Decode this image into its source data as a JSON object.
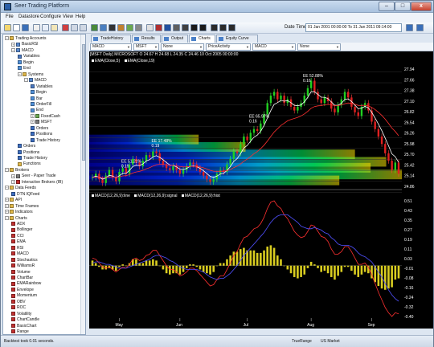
{
  "window": {
    "title": "Seer Trading Platform",
    "min_glyph": "–",
    "max_glyph": "□",
    "close_glyph": "x"
  },
  "menu": [
    "File",
    "Datastore",
    "Configure",
    "View",
    "Help"
  ],
  "toolbar": {
    "date_time_label": "Date Time",
    "date_range": "01 Jan 2001 00:00:00 To 31 Jan 2011 09:14:00"
  },
  "tree": [
    {
      "label": "Trading Accounts",
      "level": 0,
      "exp": "−",
      "color": "#e0b84a"
    },
    {
      "label": "BasicRSI",
      "level": 1,
      "exp": "+",
      "color": "#5a8ad0"
    },
    {
      "label": "MACD",
      "level": 1,
      "exp": "−",
      "color": "#5a8ad0"
    },
    {
      "label": "Variables",
      "level": 2,
      "exp": "",
      "color": "#4a78c0"
    },
    {
      "label": "Begin",
      "level": 2,
      "exp": "",
      "color": "#5090d8"
    },
    {
      "label": "End",
      "level": 2,
      "exp": "",
      "color": "#5090d8"
    },
    {
      "label": "Systems",
      "level": 2,
      "exp": "−",
      "color": "#e0b84a"
    },
    {
      "label": "MACD",
      "level": 3,
      "exp": "−",
      "color": "#5a8ad0"
    },
    {
      "label": "Variables",
      "level": 4,
      "exp": "",
      "color": "#4a78c0"
    },
    {
      "label": "Begin",
      "level": 4,
      "exp": "",
      "color": "#5090d8"
    },
    {
      "label": "Bar",
      "level": 4,
      "exp": "",
      "color": "#5090d8"
    },
    {
      "label": "OrderFill",
      "level": 4,
      "exp": "",
      "color": "#5090d8"
    },
    {
      "label": "End",
      "level": 4,
      "exp": "",
      "color": "#5090d8"
    },
    {
      "label": "FixedCash",
      "level": 4,
      "exp": "+",
      "color": "#6aa84f"
    },
    {
      "label": "MSFT",
      "level": 4,
      "exp": "+",
      "color": "#7a7a7a"
    },
    {
      "label": "Orders",
      "level": 4,
      "exp": "",
      "color": "#3c6ec0"
    },
    {
      "label": "Positions",
      "level": 4,
      "exp": "",
      "color": "#3c6ec0"
    },
    {
      "label": "Trade History",
      "level": 4,
      "exp": "",
      "color": "#3c6ec0"
    },
    {
      "label": "Orders",
      "level": 2,
      "exp": "",
      "color": "#3c6ec0"
    },
    {
      "label": "Positions",
      "level": 2,
      "exp": "",
      "color": "#3c6ec0"
    },
    {
      "label": "Trade History",
      "level": 2,
      "exp": "",
      "color": "#3c6ec0"
    },
    {
      "label": "Functions",
      "level": 2,
      "exp": "",
      "color": "#e0b84a"
    },
    {
      "label": "Brokers",
      "level": 0,
      "exp": "−",
      "color": "#e0b84a"
    },
    {
      "label": "Seer - Paper Trade",
      "level": 1,
      "exp": "+",
      "color": "#7a7a7a"
    },
    {
      "label": "Interactive Brokers (IB)",
      "level": 1,
      "exp": "+",
      "color": "#c03030"
    },
    {
      "label": "Data Feeds",
      "level": 0,
      "exp": "−",
      "color": "#e0b84a"
    },
    {
      "label": "DTN IQFeed",
      "level": 1,
      "exp": "",
      "color": "#3c6ec0"
    },
    {
      "label": "API",
      "level": 0,
      "exp": "+",
      "color": "#e0b84a"
    },
    {
      "label": "Time Frames",
      "level": 0,
      "exp": "+",
      "color": "#e0b84a"
    },
    {
      "label": "Indicators",
      "level": 0,
      "exp": "+",
      "color": "#e0b84a"
    },
    {
      "label": "Charts",
      "level": 0,
      "exp": "−",
      "color": "#e0b84a"
    },
    {
      "label": "ADX",
      "level": 1,
      "exp": "",
      "color": "#c03030"
    },
    {
      "label": "Bollinger",
      "level": 1,
      "exp": "",
      "color": "#c03030"
    },
    {
      "label": "CCI",
      "level": 1,
      "exp": "",
      "color": "#c03030"
    },
    {
      "label": "EMA",
      "level": 1,
      "exp": "",
      "color": "#c03030"
    },
    {
      "label": "RSI",
      "level": 1,
      "exp": "",
      "color": "#c03030"
    },
    {
      "label": "MACD",
      "level": 1,
      "exp": "",
      "color": "#c03030"
    },
    {
      "label": "Stochastics",
      "level": 1,
      "exp": "",
      "color": "#c03030"
    },
    {
      "label": "WilliamsR",
      "level": 1,
      "exp": "",
      "color": "#c03030"
    },
    {
      "label": "Volume",
      "level": 1,
      "exp": "",
      "color": "#c03030"
    },
    {
      "label": "ChartBar",
      "level": 1,
      "exp": "",
      "color": "#c03030"
    },
    {
      "label": "EMARainbow",
      "level": 1,
      "exp": "",
      "color": "#c03030"
    },
    {
      "label": "Envelope",
      "level": 1,
      "exp": "",
      "color": "#c03030"
    },
    {
      "label": "Momentum",
      "level": 1,
      "exp": "",
      "color": "#c03030"
    },
    {
      "label": "OBV",
      "level": 1,
      "exp": "",
      "color": "#c03030"
    },
    {
      "label": "ROC",
      "level": 1,
      "exp": "",
      "color": "#c03030"
    },
    {
      "label": "Volatility",
      "level": 1,
      "exp": "",
      "color": "#c03030"
    },
    {
      "label": "ChartCandle",
      "level": 1,
      "exp": "",
      "color": "#c03030"
    },
    {
      "label": "BasicChart",
      "level": 1,
      "exp": "",
      "color": "#c03030"
    },
    {
      "label": "Range",
      "level": 1,
      "exp": "",
      "color": "#c03030"
    }
  ],
  "tabs": [
    "TradeHistory",
    "Results",
    "Output",
    "Charts",
    "Equity Curve"
  ],
  "active_tab": "Charts",
  "selectors": [
    "MACD",
    "MSFT",
    "None",
    "PriceActivity",
    "MACD",
    "None"
  ],
  "chart": {
    "symbol_line": "[MSFT Daily] MICROSOFT O 24.67 H 24.68 L 24.35 C 24.46 10 Oct 2005 00:00:00",
    "ema_legend": [
      "EMA(Close,5)",
      "EMA(Close,19)"
    ],
    "macd_legend": [
      "MACD(12,26,9):line",
      "MACD(12,26,9):signal",
      "MACD(12,26,9):hist"
    ],
    "price_labels": [
      "27.94",
      "27.66",
      "27.38",
      "27.10",
      "26.82",
      "26.54",
      "26.26",
      "25.98",
      "25.70",
      "25.42",
      "25.14",
      "24.86"
    ],
    "macd_labels": [
      "0.51",
      "0.43",
      "0.35",
      "0.27",
      "0.19",
      "0.11",
      "0.03",
      "-0.01",
      "-0.08",
      "-0.16",
      "-0.24",
      "-0.32",
      "-0.40"
    ],
    "month_labels": [
      "May",
      "Jun",
      "Jul",
      "Aug",
      "Sep"
    ],
    "trade_annotations": [
      {
        "text": "EE 51.21%",
        "sub": "0.19"
      },
      {
        "text": "EE 17.48%",
        "sub": "0.19"
      },
      {
        "text": "EE 65.97%",
        "sub": "0.16"
      },
      {
        "text": "EE 52.88%",
        "sub": "0.16"
      }
    ]
  },
  "chart_data": {
    "type": "line",
    "title": "[MSFT Daily] MICROSOFT O 24.67 H 24.68 L 24.35 C 24.46 10 Oct 2005 00:00:00",
    "xlabel": "",
    "ylabel": "",
    "x_ticks": [
      "May",
      "Jun",
      "Jul",
      "Aug",
      "Sep"
    ],
    "ylim": [
      24.86,
      28.1
    ],
    "price_close": [
      25.1,
      25.2,
      25.05,
      24.95,
      25.15,
      25.3,
      25.1,
      25.0,
      25.25,
      25.35,
      25.2,
      25.45,
      25.6,
      25.5,
      25.4,
      25.55,
      25.7,
      25.65,
      25.8,
      25.75,
      25.55,
      25.45,
      25.35,
      25.3,
      25.4,
      25.3,
      25.2,
      25.3,
      25.4,
      25.5,
      25.45,
      25.35,
      25.25,
      25.15,
      25.05,
      24.98,
      25.05,
      25.2,
      25.3,
      25.25,
      25.45,
      25.6,
      25.8,
      25.75,
      26.0,
      26.2,
      26.1,
      26.3,
      26.4,
      26.35,
      26.55,
      26.8,
      27.1,
      27.3,
      27.4,
      27.2,
      27.3,
      27.1,
      27.2,
      27.0,
      26.9,
      27.0,
      27.1,
      27.3,
      27.5,
      27.7,
      27.4,
      27.2,
      27.1,
      27.25,
      27.15,
      26.95,
      26.85,
      27.05,
      27.2,
      27.4,
      27.25,
      27.0,
      26.85,
      26.75,
      27.0,
      27.1,
      26.9,
      26.6,
      26.4,
      26.2,
      26.0,
      25.75,
      25.55,
      25.3,
      25.5,
      25.2
    ],
    "series": [
      {
        "name": "EMA(Close,5)",
        "color": "#ffffff"
      },
      {
        "name": "EMA(Close,19)",
        "color": "#ff3030"
      },
      {
        "name": "MACD(12,26,9):line",
        "color": "#ff3030"
      },
      {
        "name": "MACD(12,26,9):signal",
        "color": "#5050ff"
      },
      {
        "name": "MACD(12,26,9):hist",
        "color": "#d8cc20"
      }
    ],
    "macd_ylim": [
      -0.4,
      0.51
    ],
    "macd_line": [
      0.06,
      0.05,
      0.02,
      -0.01,
      -0.02,
      -0.01,
      -0.03,
      -0.05,
      -0.03,
      -0.01,
      -0.02,
      0.01,
      0.05,
      0.06,
      0.04,
      0.05,
      0.08,
      0.09,
      0.12,
      0.12,
      0.08,
      0.04,
      0.0,
      -0.03,
      -0.03,
      -0.05,
      -0.08,
      -0.07,
      -0.05,
      -0.02,
      -0.02,
      -0.04,
      -0.07,
      -0.1,
      -0.13,
      -0.16,
      -0.15,
      -0.11,
      -0.08,
      -0.08,
      -0.03,
      0.02,
      0.08,
      0.11,
      0.17,
      0.22,
      0.23,
      0.26,
      0.29,
      0.3,
      0.33,
      0.38,
      0.45,
      0.5,
      0.51,
      0.47,
      0.45,
      0.4,
      0.37,
      0.32,
      0.27,
      0.24,
      0.22,
      0.23,
      0.27,
      0.32,
      0.31,
      0.27,
      0.23,
      0.22,
      0.19,
      0.13,
      0.09,
      0.09,
      0.11,
      0.15,
      0.15,
      0.11,
      0.06,
      0.01,
      0.01,
      0.02,
      -0.01,
      -0.07,
      -0.14,
      -0.21,
      -0.27,
      -0.33,
      -0.37,
      -0.4,
      -0.37,
      -0.38
    ],
    "macd_signal": [
      0.02,
      0.03,
      0.03,
      0.02,
      0.01,
      0.01,
      0.0,
      -0.01,
      -0.02,
      -0.02,
      -0.02,
      -0.01,
      0.0,
      0.01,
      0.02,
      0.03,
      0.04,
      0.05,
      0.07,
      0.08,
      0.08,
      0.07,
      0.06,
      0.04,
      0.03,
      0.01,
      -0.01,
      -0.02,
      -0.03,
      -0.03,
      -0.03,
      -0.03,
      -0.04,
      -0.05,
      -0.07,
      -0.09,
      -0.1,
      -0.11,
      -0.1,
      -0.1,
      -0.08,
      -0.06,
      -0.03,
      0.0,
      0.04,
      0.08,
      0.11,
      0.14,
      0.17,
      0.2,
      0.23,
      0.26,
      0.3,
      0.34,
      0.37,
      0.39,
      0.4,
      0.4,
      0.4,
      0.38,
      0.36,
      0.34,
      0.31,
      0.3,
      0.29,
      0.29,
      0.3,
      0.29,
      0.28,
      0.26,
      0.25,
      0.22,
      0.2,
      0.17,
      0.16,
      0.16,
      0.16,
      0.15,
      0.13,
      0.1,
      0.08,
      0.07,
      0.05,
      0.03,
      -0.01,
      -0.05,
      -0.09,
      -0.14,
      -0.19,
      -0.23,
      -0.26,
      -0.28
    ]
  }
}
